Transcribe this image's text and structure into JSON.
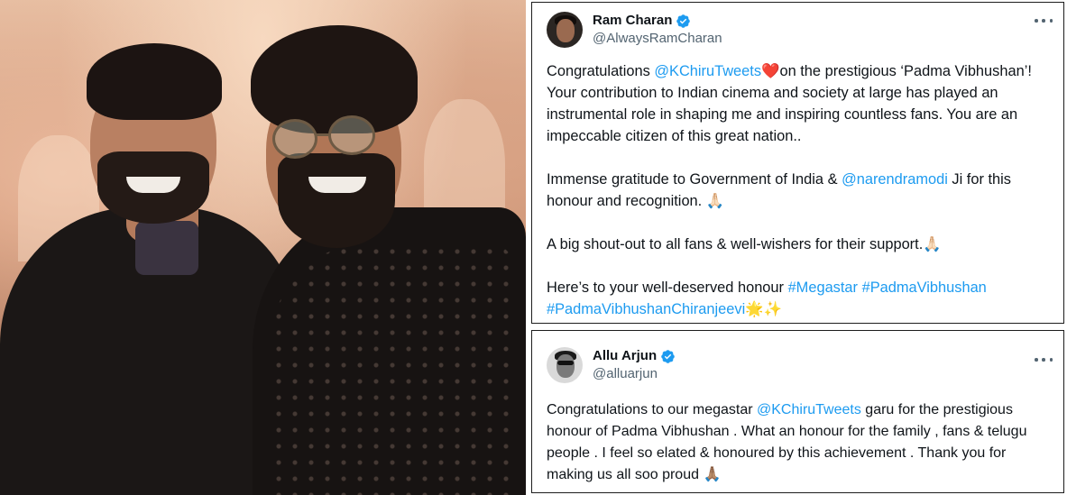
{
  "colors": {
    "link": "#1d9bf0",
    "text": "#0f1419",
    "secondary": "#536471",
    "verified": "#1d9bf0"
  },
  "photo": {
    "description_icon": "photo-of-two-men"
  },
  "tweets": [
    {
      "display_name": "Ram Charan",
      "handle": "@AlwaysRamCharan",
      "verified": true,
      "more_icon": "more-options-icon",
      "paragraphs": [
        {
          "segments": [
            {
              "text": "Congratulations ",
              "type": "text"
            },
            {
              "text": "@KChiruTweets",
              "type": "mention"
            },
            {
              "text": " ❤️",
              "type": "emoji"
            },
            {
              "text": "on the prestigious ‘Padma Vibhushan’! Your contribution to Indian cinema and society at large has played an instrumental role in shaping me and inspiring countless fans. You are an impeccable citizen of this great nation..",
              "type": "text"
            }
          ]
        },
        {
          "segments": [
            {
              "text": "Immense gratitude to Government of India & ",
              "type": "text"
            },
            {
              "text": "@narendramodi",
              "type": "mention"
            },
            {
              "text": " Ji for this honour and recognition. ",
              "type": "text"
            },
            {
              "text": "🙏🏻",
              "type": "emoji"
            }
          ]
        },
        {
          "segments": [
            {
              "text": "A big shout-out to all fans & well-wishers for their support.",
              "type": "text"
            },
            {
              "text": "🙏🏻",
              "type": "emoji"
            }
          ]
        },
        {
          "segments": [
            {
              "text": "Here’s to your well-deserved honour ",
              "type": "text"
            },
            {
              "text": "#Megastar",
              "type": "hashtag"
            },
            {
              "text": " ",
              "type": "text"
            },
            {
              "text": "#PadmaVibhushan",
              "type": "hashtag"
            },
            {
              "text": " ",
              "type": "text"
            },
            {
              "text": "#PadmaVibhushanChiranjeevi",
              "type": "hashtag"
            },
            {
              "text": " 🌟✨",
              "type": "emoji"
            }
          ]
        }
      ]
    },
    {
      "display_name": "Allu Arjun",
      "handle": "@alluarjun",
      "verified": true,
      "more_icon": "more-options-icon",
      "paragraphs": [
        {
          "segments": [
            {
              "text": "Congratulations to our megastar ",
              "type": "text"
            },
            {
              "text": "@KChiruTweets",
              "type": "mention"
            },
            {
              "text": " garu for the prestigious honour of Padma Vibhushan . What an honour for the family , fans & telugu people . I feel so elated  & honoured by this achievement . Thank you for making us all soo proud ",
              "type": "text"
            },
            {
              "text": "🙏🏽",
              "type": "emoji"
            }
          ]
        }
      ]
    }
  ]
}
